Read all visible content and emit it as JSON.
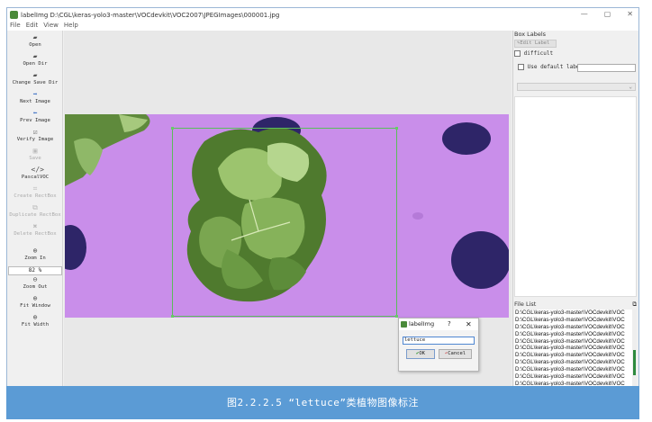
{
  "window": {
    "title": "labelImg D:\\CGL\\keras-yolo3-master\\VOCdevkit\\VOC2007\\JPEGImages\\000001.jpg",
    "controls": [
      "—",
      "▢",
      "✕"
    ]
  },
  "menu": [
    "File",
    "Edit",
    "View",
    "Help"
  ],
  "toolbar": {
    "open": "Open",
    "open_dir": "Open Dir",
    "change_save_dir": "Change Save Dir",
    "next_image": "Next Image",
    "prev_image": "Prev Image",
    "verify_image": "Verify Image",
    "save": "Save",
    "format": "PascalVOC",
    "create_rectbox": "Create RectBox",
    "duplicate_rectbox": "Duplicate RectBox",
    "delete_rectbox": "Delete RectBox",
    "zoom_in": "Zoom In",
    "zoom_value": "82 %",
    "zoom_out": "Zoom Out",
    "fit_window": "Fit Window",
    "fit_width": "Fit Width"
  },
  "box_labels": {
    "title": "Box Labels",
    "edit_label": "Edit Label",
    "difficult": "difficult",
    "use_default_label": "Use default label"
  },
  "file_list": {
    "title": "File List",
    "items": [
      "D:\\CGL\\keras-yolo3-master\\VOCdevkit\\VOC",
      "D:\\CGL\\keras-yolo3-master\\VOCdevkit\\VOC",
      "D:\\CGL\\keras-yolo3-master\\VOCdevkit\\VOC",
      "D:\\CGL\\keras-yolo3-master\\VOCdevkit\\VOC",
      "D:\\CGL\\keras-yolo3-master\\VOCdevkit\\VOC",
      "D:\\CGL\\keras-yolo3-master\\VOCdevkit\\VOC",
      "D:\\CGL\\keras-yolo3-master\\VOCdevkit\\VOC",
      "D:\\CGL\\keras-yolo3-master\\VOCdevkit\\VOC",
      "D:\\CGL\\keras-yolo3-master\\VOCdevkit\\VOC",
      "D:\\CGL\\keras-yolo3-master\\VOCdevkit\\VOC",
      "D:\\CGL\\keras-yolo3-master\\VOCdevkit\\VOC"
    ]
  },
  "dialog": {
    "title": "labelImg",
    "help": "?",
    "close": "✕",
    "input_value": "lettuce",
    "ok": "OK",
    "cancel": "Cancel"
  },
  "caption": "图2.2.2.5 “lettuce”类植物图像标注",
  "colors": {
    "photo_background": "#c388e6",
    "bbox": "#5bbd5b",
    "caption_bar": "#5b9bd5"
  }
}
